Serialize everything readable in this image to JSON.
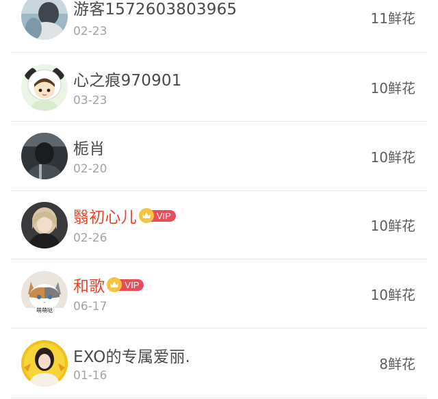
{
  "flower_list": [
    {
      "name": "游客1572603803965",
      "date": "02-23",
      "count": "11鲜花",
      "vip": false,
      "avatar": "blurred-photo-avatar"
    },
    {
      "name": "心之痕970901",
      "date": "03-23",
      "count": "10鲜花",
      "vip": false,
      "avatar": "panda-hood-girl-cartoon-avatar"
    },
    {
      "name": "栀肖",
      "date": "02-20",
      "count": "10鲜花",
      "vip": false,
      "avatar": "dark-portrait-avatar"
    },
    {
      "name": "翳初心儿",
      "date": "02-26",
      "count": "10鲜花",
      "vip": true,
      "vip_label": "VIP",
      "avatar": "blonde-girl-photo-avatar"
    },
    {
      "name": "和歌",
      "date": "06-17",
      "count": "10鲜花",
      "vip": true,
      "vip_label": "VIP",
      "avatar": "kitten-photo-avatar",
      "avatar_caption": "萌萌哒"
    },
    {
      "name": "EXO的专属爱丽.",
      "date": "01-16",
      "count": "8鲜花",
      "vip": false,
      "avatar": "girl-yellow-background-avatar"
    }
  ],
  "colors": {
    "vip_name": "#e8462b",
    "vip_tag": "#ea4d5a",
    "crown": "#f7c33d",
    "divider": "#e7e7e7"
  }
}
